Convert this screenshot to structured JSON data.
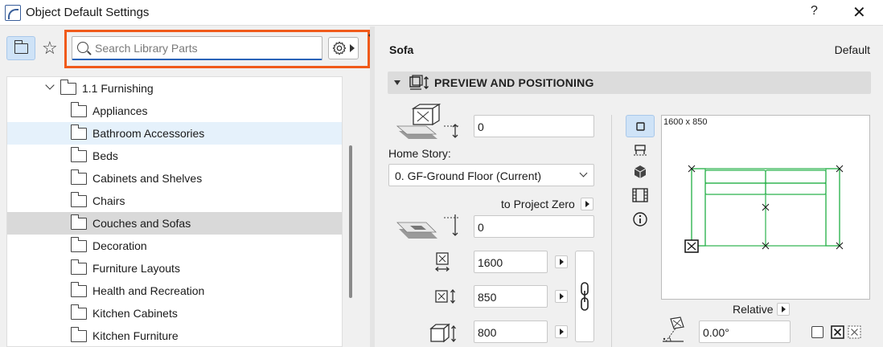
{
  "window": {
    "title": "Object Default Settings",
    "help": "?",
    "close": "✕"
  },
  "library": {
    "search_placeholder": "Search Library Parts",
    "search_value": "",
    "tree": [
      {
        "label": "1.1 Furnishing",
        "level": 0,
        "expanded": true
      },
      {
        "label": "Appliances",
        "level": 1
      },
      {
        "label": "Bathroom Accessories",
        "level": 1,
        "state": "hover"
      },
      {
        "label": "Beds",
        "level": 1
      },
      {
        "label": "Cabinets and Shelves",
        "level": 1
      },
      {
        "label": "Chairs",
        "level": 1
      },
      {
        "label": "Couches and Sofas",
        "level": 1,
        "state": "selected"
      },
      {
        "label": "Decoration",
        "level": 1
      },
      {
        "label": "Furniture Layouts",
        "level": 1
      },
      {
        "label": "Health and Recreation",
        "level": 1
      },
      {
        "label": "Kitchen Cabinets",
        "level": 1
      },
      {
        "label": "Kitchen Furniture",
        "level": 1
      }
    ]
  },
  "settings": {
    "object_name": "Sofa",
    "preset": "Default",
    "section_title": "PREVIEW AND POSITIONING",
    "elevation_to_story": "0",
    "home_story_label": "Home Story:",
    "home_story_value": "0. GF-Ground Floor (Current)",
    "to_project_zero_label": "to Project Zero",
    "elevation_to_project_zero": "0",
    "width": "1600",
    "depth": "850",
    "height": "800",
    "preview_size": "1600 x 850",
    "relative_label": "Relative",
    "rotation": "0.00°"
  }
}
